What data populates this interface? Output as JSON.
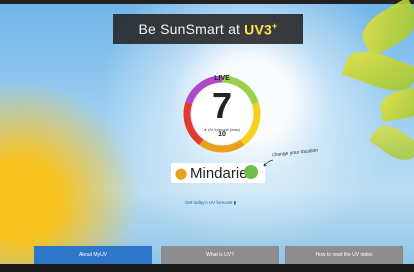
{
  "header": {
    "title_prefix": "Be SunSmart at",
    "brand": "UV3",
    "brand_sup": "+"
  },
  "gauge": {
    "live_label": "LIVE",
    "uv_value": "7",
    "peak_label": "UV forecast (max)",
    "peak_value": "10",
    "colors": [
      "#f7d11e",
      "#9bd04b",
      "#e8a11c",
      "#e23a2f",
      "#b049c9"
    ]
  },
  "location": {
    "name": "Mindarie",
    "change_hint": "change your location"
  },
  "links": {
    "forecast": "Get today's UV forecast"
  },
  "tabs": [
    {
      "label": "About MyUV"
    },
    {
      "label": "What is UV?"
    },
    {
      "label": "How to read the UV index"
    }
  ],
  "icons": {
    "pin": "location-pin-icon",
    "go": "go-arrow-icon",
    "calendar": "calendar-icon"
  }
}
